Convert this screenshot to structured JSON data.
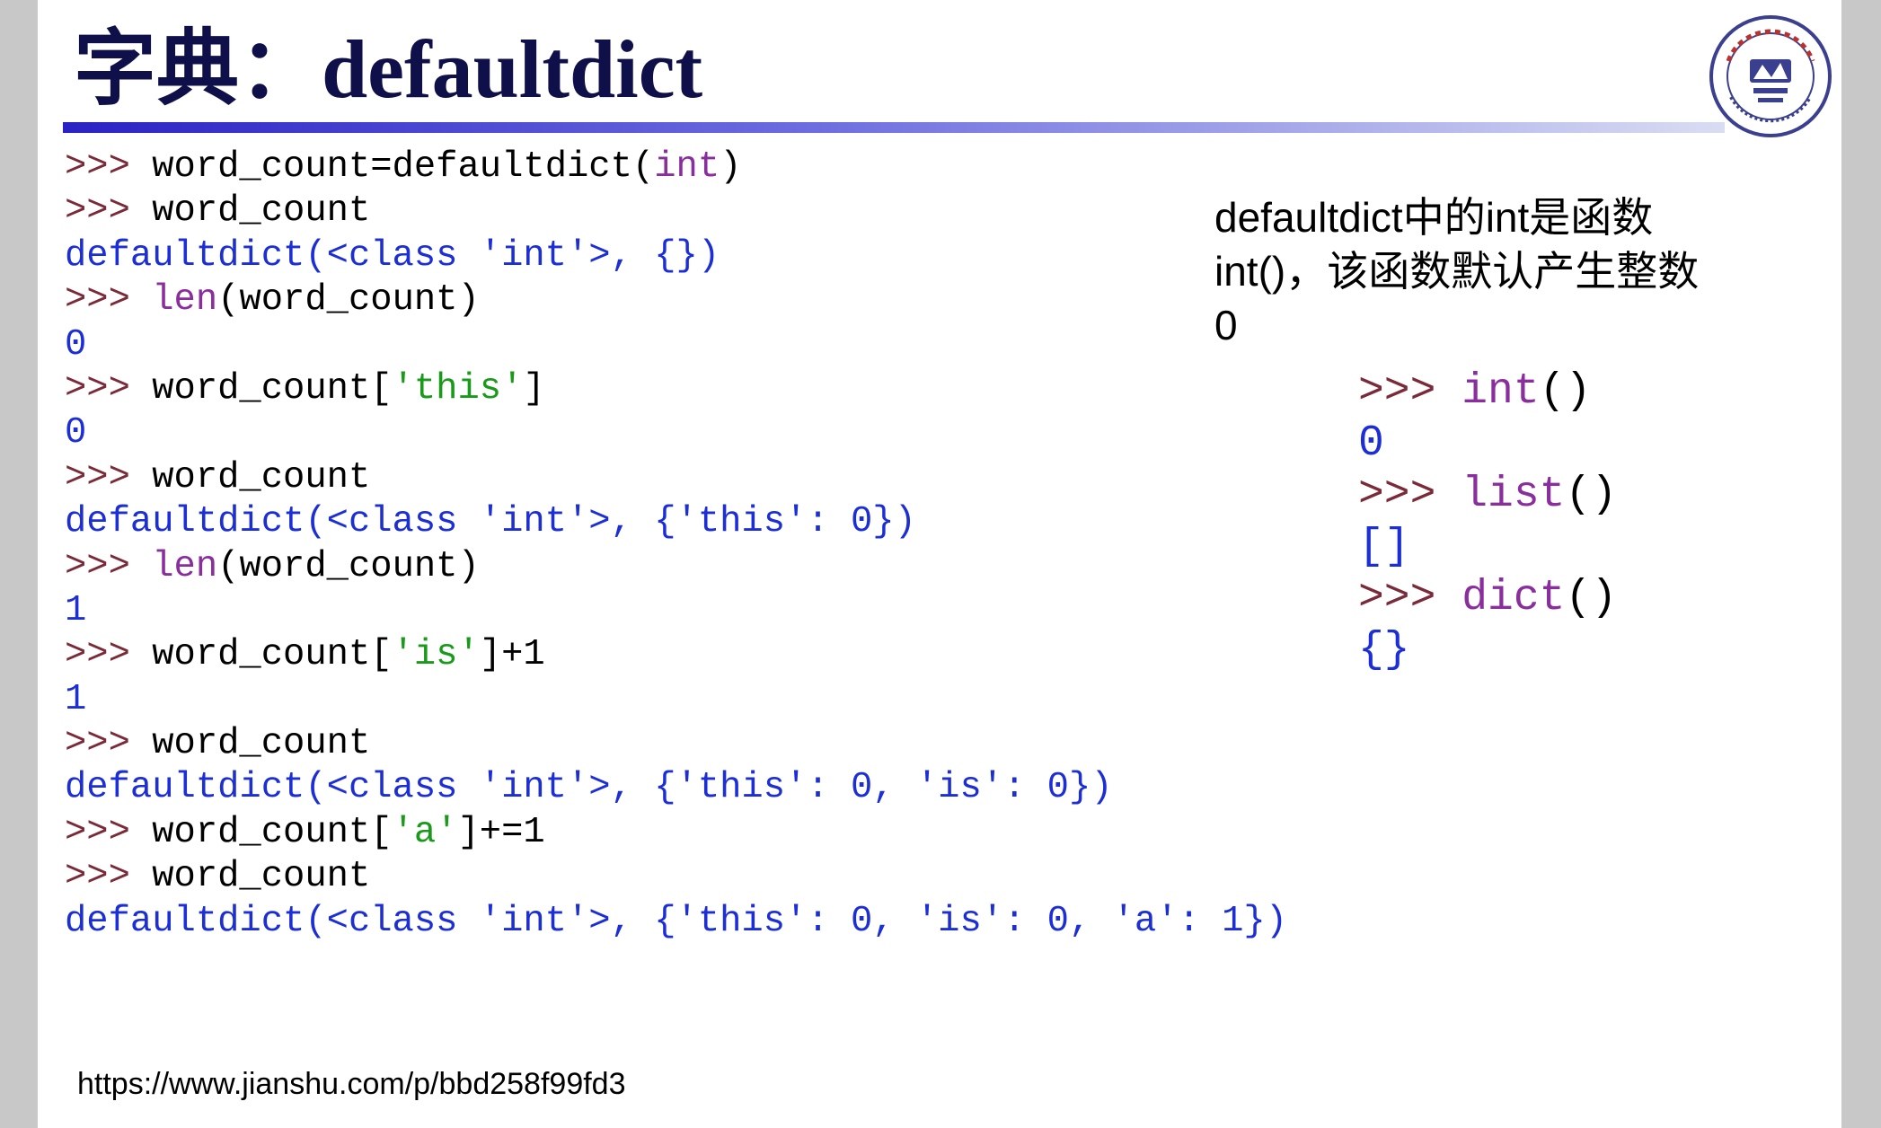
{
  "title": "字典：defaultdict",
  "code_lines": [
    [
      {
        "t": ">>> ",
        "c": "p"
      },
      {
        "t": "word_count=defaultdict(",
        "c": "d"
      },
      {
        "t": "int",
        "c": "kw"
      },
      {
        "t": ")",
        "c": "d"
      }
    ],
    [
      {
        "t": ">>> ",
        "c": "p"
      },
      {
        "t": "word_count",
        "c": "d"
      }
    ],
    [
      {
        "t": "defaultdict(<class 'int'>, {})",
        "c": "o"
      }
    ],
    [
      {
        "t": ">>> ",
        "c": "p"
      },
      {
        "t": "len",
        "c": "kw"
      },
      {
        "t": "(word_count)",
        "c": "d"
      }
    ],
    [
      {
        "t": "0",
        "c": "o"
      }
    ],
    [
      {
        "t": ">>> ",
        "c": "p"
      },
      {
        "t": "word_count[",
        "c": "d"
      },
      {
        "t": "'this'",
        "c": "s"
      },
      {
        "t": "]",
        "c": "d"
      }
    ],
    [
      {
        "t": "0",
        "c": "o"
      }
    ],
    [
      {
        "t": ">>> ",
        "c": "p"
      },
      {
        "t": "word_count",
        "c": "d"
      }
    ],
    [
      {
        "t": "defaultdict(<class 'int'>, {'this': 0})",
        "c": "o"
      }
    ],
    [
      {
        "t": ">>> ",
        "c": "p"
      },
      {
        "t": "len",
        "c": "kw"
      },
      {
        "t": "(word_count)",
        "c": "d"
      }
    ],
    [
      {
        "t": "1",
        "c": "o"
      }
    ],
    [
      {
        "t": ">>> ",
        "c": "p"
      },
      {
        "t": "word_count[",
        "c": "d"
      },
      {
        "t": "'is'",
        "c": "s"
      },
      {
        "t": "]+1",
        "c": "d"
      }
    ],
    [
      {
        "t": "1",
        "c": "o"
      }
    ],
    [
      {
        "t": ">>> ",
        "c": "p"
      },
      {
        "t": "word_count",
        "c": "d"
      }
    ],
    [
      {
        "t": "defaultdict(<class 'int'>, {'this': 0, 'is': 0})",
        "c": "o"
      }
    ],
    [
      {
        "t": ">>> ",
        "c": "p"
      },
      {
        "t": "word_count[",
        "c": "d"
      },
      {
        "t": "'a'",
        "c": "s"
      },
      {
        "t": "]+=1",
        "c": "d"
      }
    ],
    [
      {
        "t": ">>> ",
        "c": "p"
      },
      {
        "t": "word_count",
        "c": "d"
      }
    ],
    [
      {
        "t": "defaultdict(<class 'int'>, {'this': 0, 'is': 0, 'a': 1})",
        "c": "o"
      }
    ]
  ],
  "note_lines": [
    "defaultdict中的int是函数",
    "int()，该函数默认产生整数",
    "0"
  ],
  "side_code_lines": [
    [
      {
        "t": ">>> ",
        "c": "p"
      },
      {
        "t": "int",
        "c": "kw"
      },
      {
        "t": "()",
        "c": "d"
      }
    ],
    [
      {
        "t": "0",
        "c": "o"
      }
    ],
    [
      {
        "t": ">>> ",
        "c": "p"
      },
      {
        "t": "list",
        "c": "kw"
      },
      {
        "t": "()",
        "c": "d"
      }
    ],
    [
      {
        "t": "[]",
        "c": "o"
      }
    ],
    [
      {
        "t": ">>> ",
        "c": "p"
      },
      {
        "t": "dict",
        "c": "kw"
      },
      {
        "t": "()",
        "c": "d"
      }
    ],
    [
      {
        "t": "{}",
        "c": "o"
      }
    ]
  ],
  "url": "https://www.jianshu.com/p/bbd258f99fd3",
  "logo": {
    "icon": "university-seal-icon",
    "text": "华中科技大学"
  },
  "colors": {
    "title": "#0f0f4a",
    "prompt": "#7a2a38",
    "keyword": "#8a2e9e",
    "output": "#1c2ed6",
    "string": "#1a9a1a",
    "rule_start": "#2a22c4"
  }
}
